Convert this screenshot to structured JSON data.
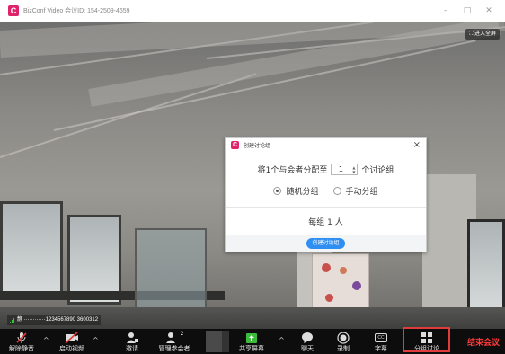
{
  "window": {
    "title": "BizConf Video 会议ID: 154-2509-4659",
    "logo_letter": "C",
    "minimize": "–",
    "maximize": "□",
    "close": "✕"
  },
  "video": {
    "fullscreen_label": "进入全屏",
    "speaker_label": "静 ············1234567890 3600312"
  },
  "dialog": {
    "title": "创建讨论组",
    "logo_letter": "C",
    "close": "×",
    "assign_prefix": "将1个与会者分配至",
    "group_count": "1",
    "assign_suffix": "个讨论组",
    "options": [
      {
        "label": "随机分组",
        "checked": true
      },
      {
        "label": "手动分组",
        "checked": false
      }
    ],
    "per_group": "每组 1 人",
    "create_button": "创建讨论组"
  },
  "toolbar": {
    "items": [
      {
        "label": "解除静音",
        "icon": "muted-mic-icon"
      },
      {
        "label": "启动视频",
        "icon": "video-off-icon"
      },
      {
        "label": "邀请",
        "icon": "invite-icon"
      },
      {
        "label": "管理参会者",
        "icon": "participants-icon",
        "count": "2"
      },
      {
        "label": "共享屏幕",
        "icon": "share-screen-icon"
      },
      {
        "label": "聊天",
        "icon": "chat-icon"
      },
      {
        "label": "录制",
        "icon": "record-icon"
      },
      {
        "label": "字幕",
        "icon": "caption-icon",
        "icon_text": "CC"
      },
      {
        "label": "分组讨论",
        "icon": "breakout-icon"
      }
    ],
    "end_meeting": "结束会议"
  },
  "colors": {
    "brand": "#e0246b",
    "primary_button": "#2f8ef1",
    "end_meeting": "#ff3b3b",
    "highlight": "#e23b3b",
    "share_green": "#3cba3c"
  }
}
